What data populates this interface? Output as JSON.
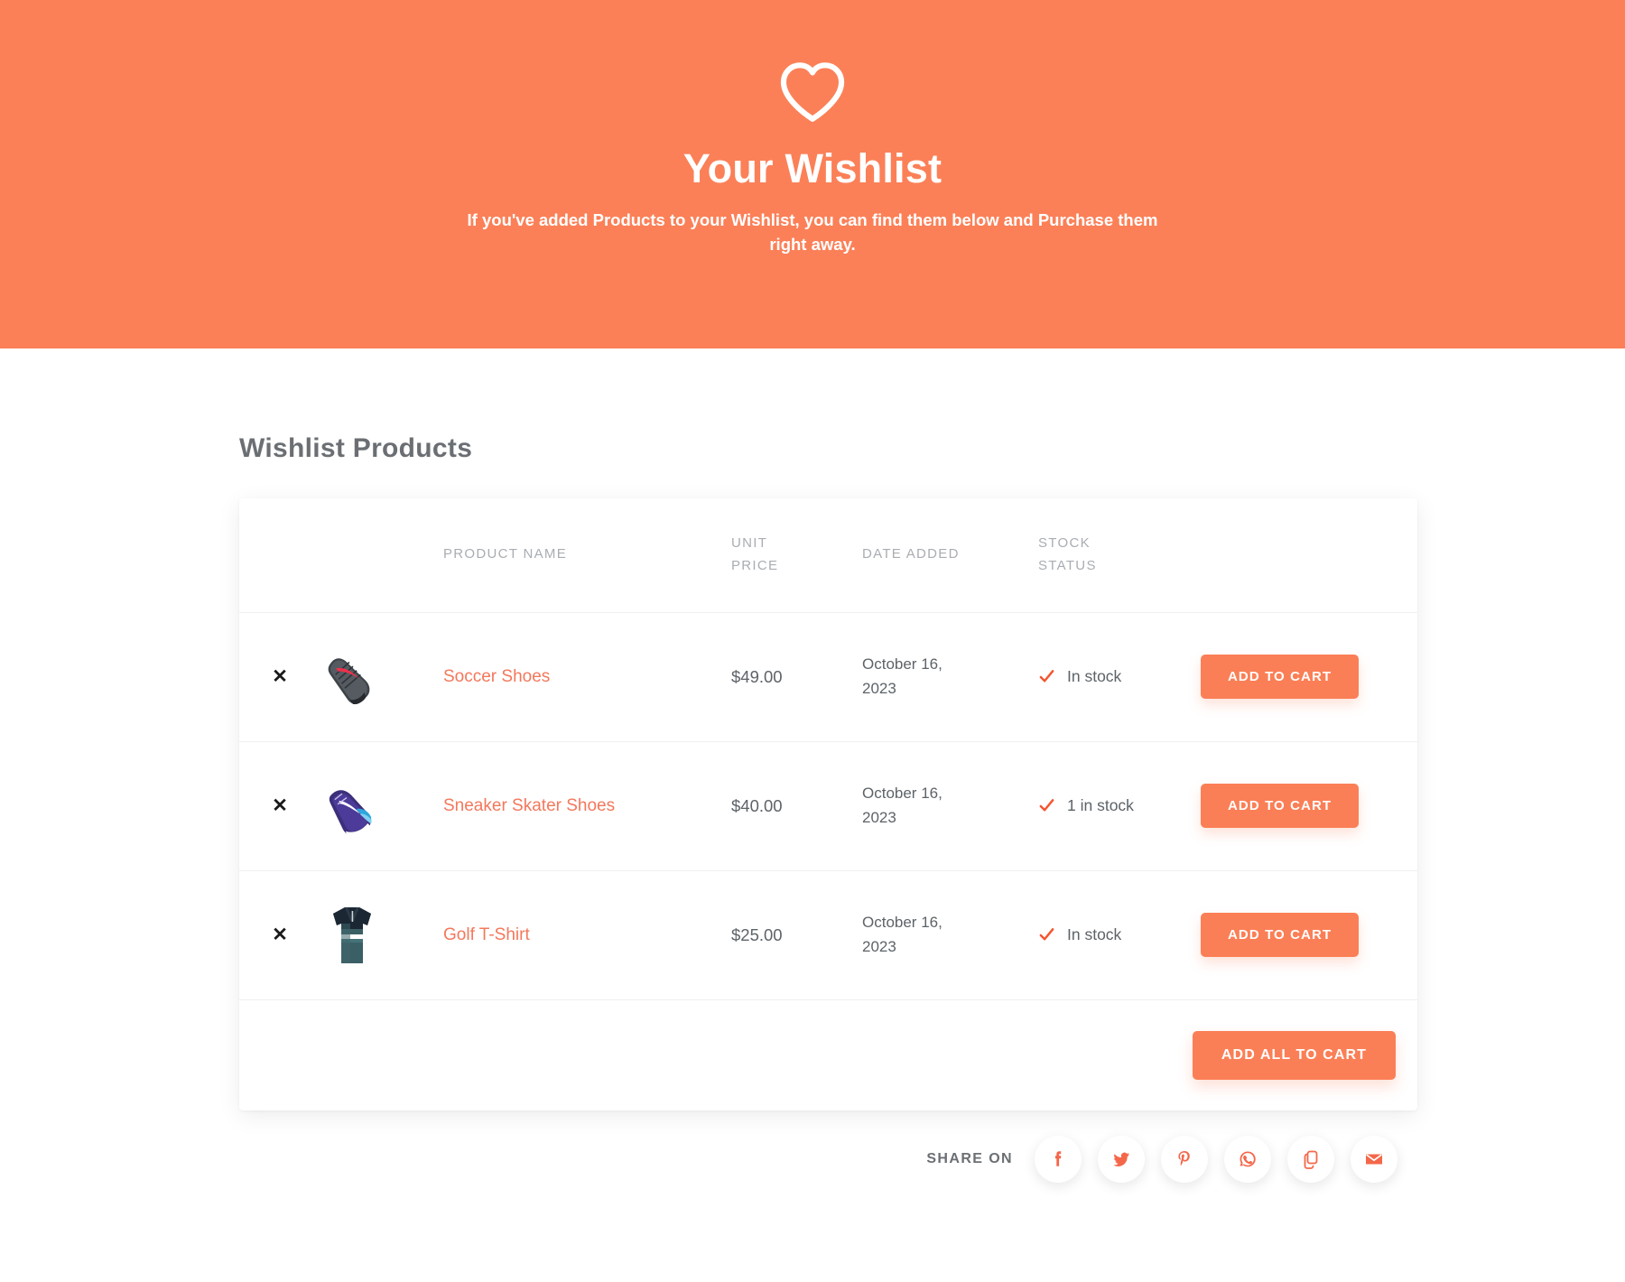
{
  "theme": {
    "accent": "#fb8058",
    "accent_button": "#fb7f56",
    "link": "#f4785c",
    "heading": "#6b6f73",
    "body_text": "#5d6368",
    "muted": "#a9adb2",
    "page_bg": "#ffffff"
  },
  "hero": {
    "icon": "heart-icon",
    "title": "Your Wishlist",
    "subtitle": "If you've added Products to your Wishlist, you can find them below and Purchase them right away."
  },
  "main": {
    "section_title": "Wishlist Products"
  },
  "table": {
    "headers": {
      "remove": "",
      "thumb": "",
      "name": "PRODUCT NAME",
      "price_line1": "UNIT",
      "price_line2": "PRICE",
      "date": "DATE ADDED",
      "stock_line1": "STOCK",
      "stock_line2": "STATUS",
      "action": ""
    },
    "remove_glyph": "✕",
    "rows": [
      {
        "remove_label": "✕",
        "thumb": "soccer-cleat-thumbnail",
        "name": "Soccer Shoes",
        "price": "$49.00",
        "date_added": "October 16, 2023",
        "stock_status": "In stock",
        "stock_icon": "check-icon",
        "action_label": "ADD TO CART"
      },
      {
        "remove_label": "✕",
        "thumb": "sneaker-thumbnail",
        "name": "Sneaker Skater Shoes",
        "price": "$40.00",
        "date_added": "October 16, 2023",
        "stock_status": "1 in stock",
        "stock_icon": "check-icon",
        "action_label": "ADD TO CART"
      },
      {
        "remove_label": "✕",
        "thumb": "polo-shirt-thumbnail",
        "name": "Golf T-Shirt",
        "price": "$25.00",
        "date_added": "October 16, 2023",
        "stock_status": "In stock",
        "stock_icon": "check-icon",
        "action_label": "ADD TO CART"
      }
    ],
    "footer_action_label": "ADD ALL TO CART"
  },
  "share": {
    "label": "SHARE ON",
    "items": [
      {
        "icon": "facebook-icon"
      },
      {
        "icon": "twitter-icon"
      },
      {
        "icon": "pinterest-icon"
      },
      {
        "icon": "whatsapp-icon"
      },
      {
        "icon": "copy-link-icon"
      },
      {
        "icon": "email-icon"
      }
    ]
  }
}
